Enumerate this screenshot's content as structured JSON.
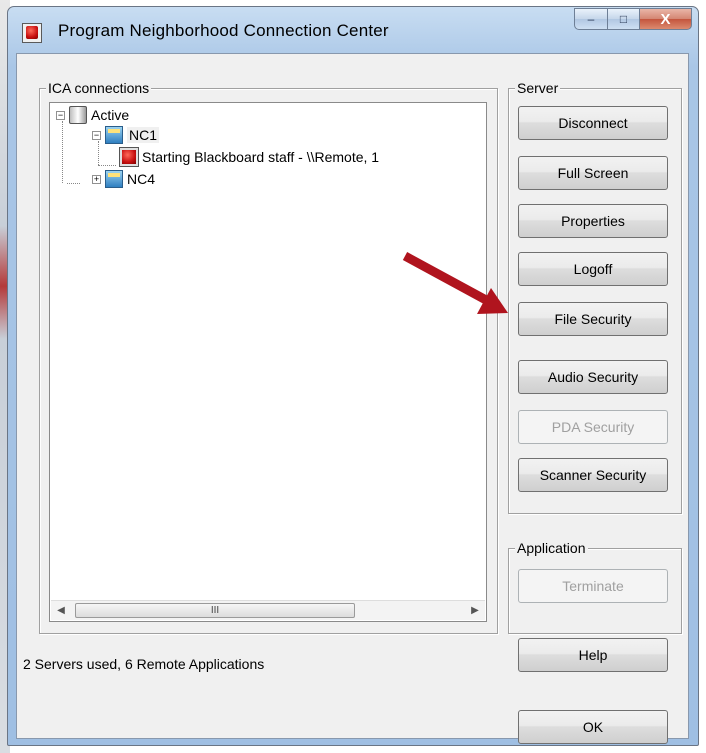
{
  "window": {
    "title": "Program Neighborhood Connection Center",
    "caption_buttons": {
      "minimize": "–",
      "maximize": "□",
      "close": "X"
    }
  },
  "ica": {
    "label": "ICA connections",
    "tree": [
      {
        "label": "Active",
        "icon": "servers-icon",
        "expander": "−"
      },
      {
        "label": "NC1",
        "icon": "folder-server-icon",
        "expander": "−",
        "selected": true
      },
      {
        "label": "Starting Blackboard staff - \\\\Remote, 1",
        "icon": "app-icon"
      },
      {
        "label": "NC4",
        "icon": "folder-server-icon",
        "expander": "+"
      }
    ],
    "scrollbar": {
      "left": "◀",
      "grip": "III",
      "right": "▶"
    }
  },
  "server": {
    "label": "Server",
    "buttons": [
      {
        "label": "Disconnect",
        "enabled": true
      },
      {
        "label": "Full Screen",
        "enabled": true
      },
      {
        "label": "Properties",
        "enabled": true
      },
      {
        "label": "Logoff",
        "enabled": true
      },
      {
        "label": "File Security",
        "enabled": true
      },
      {
        "label": "Audio Security",
        "enabled": true
      },
      {
        "label": "PDA Security",
        "enabled": false
      },
      {
        "label": "Scanner Security",
        "enabled": true
      }
    ]
  },
  "application": {
    "label": "Application",
    "terminate": {
      "label": "Terminate",
      "enabled": false
    }
  },
  "status": "2 Servers used, 6 Remote Applications",
  "footer": {
    "help": "Help",
    "ok": "OK"
  },
  "colors": {
    "annotation_arrow": "#b0141e",
    "title_bar": "#a9c6e6",
    "dialog_bg": "#f0f0f0"
  }
}
